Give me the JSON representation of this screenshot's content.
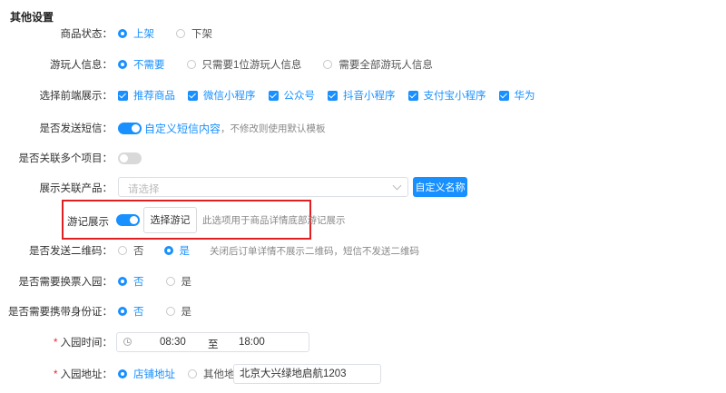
{
  "section": {
    "title": "其他设置"
  },
  "product_status": {
    "label": "商品状态：",
    "options": [
      "上架",
      "下架"
    ],
    "selected": "上架"
  },
  "visitor_info": {
    "label": "游玩人信息：",
    "options": [
      "不需要",
      "只需要1位游玩人信息",
      "需要全部游玩人信息"
    ],
    "selected": "不需要"
  },
  "frontend": {
    "label": "选择前端展示：",
    "options": [
      "推荐商品",
      "微信小程序",
      "公众号",
      "抖音小程序",
      "支付宝小程序",
      "华为"
    ]
  },
  "sms": {
    "label": "是否发送短信：",
    "toggle": "on",
    "link": "自定义短信内容",
    "hint": "，不修改则使用默认模板"
  },
  "multi_items": {
    "label": "是否关联多个项目：",
    "toggle": "off"
  },
  "related_products": {
    "label": "展示关联产品：",
    "placeholder": "请选择",
    "button": "自定义名称"
  },
  "travel_notes": {
    "label": "游记展示",
    "toggle": "on",
    "button": "选择游记",
    "hint": "此选项用于商品详情底部游记展示"
  },
  "qrcode": {
    "label": "是否发送二维码：",
    "options": [
      "否",
      "是"
    ],
    "selected": "是",
    "hint": "关闭后订单详情不展示二维码，短信不发送二维码"
  },
  "exchange_ticket": {
    "label": "是否需要换票入园：",
    "options": [
      "否",
      "是"
    ],
    "selected": "否"
  },
  "id_card": {
    "label": "是否需要携带身份证：",
    "options": [
      "否",
      "是"
    ],
    "selected": "否"
  },
  "entry_time": {
    "required_mark": "*",
    "label": "入园时间：",
    "start": "08:30",
    "separator": "至",
    "end": "18:00"
  },
  "entry_address": {
    "required_mark": "*",
    "label": "入园地址：",
    "options": [
      "店铺地址",
      "其他地址"
    ],
    "selected": "店铺地址",
    "value": "北京大兴绿地启航1203"
  },
  "colors": {
    "accent": "#1890ff",
    "highlight_border": "#e02020"
  }
}
